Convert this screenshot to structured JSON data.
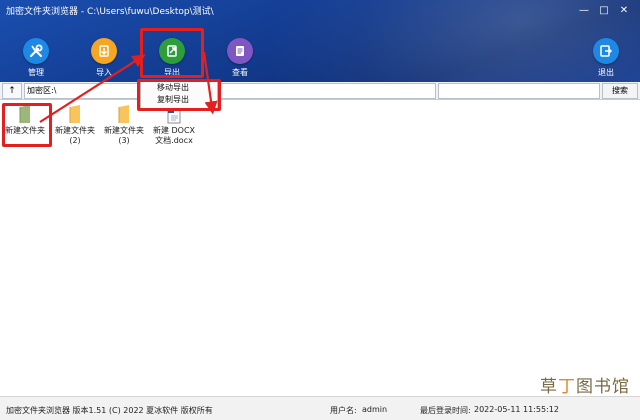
{
  "window": {
    "title": "加密文件夹浏览器  - C:\\Users\\fuwu\\Desktop\\测试\\",
    "minimize": "—",
    "maximize": "□",
    "close": "✕"
  },
  "toolbar": {
    "manage": {
      "label": "管理",
      "icon": "wrench-screwdriver-icon",
      "color": "#1e88e5"
    },
    "import": {
      "label": "导入",
      "icon": "import-file-icon",
      "color": "#f5a623"
    },
    "export": {
      "label": "导出",
      "icon": "export-file-icon",
      "color": "#2e9d3b"
    },
    "view": {
      "label": "查看",
      "icon": "view-document-icon",
      "color": "#7e57c2"
    },
    "exit": {
      "label": "退出",
      "icon": "exit-icon",
      "color": "#1e88e5"
    }
  },
  "addressbar": {
    "up": "↑",
    "path": "加密区:\\",
    "search_value": "",
    "search_button": "搜索"
  },
  "export_menu": {
    "items": [
      "移动导出",
      "复制导出"
    ]
  },
  "files": [
    {
      "name": "新建文件夹",
      "type": "folder"
    },
    {
      "name": "新建文件夹\n(2)",
      "type": "folder"
    },
    {
      "name": "新建文件夹\n(3)",
      "type": "folder"
    },
    {
      "name": "新建 DOCX\n文档.docx",
      "type": "docx"
    }
  ],
  "statusbar": {
    "app_info": "加密文件夹浏览器 版本1.51 (C) 2022 夏冰软件 版权所有",
    "user_label": "用户名:",
    "user_value": "admin",
    "login_label": "最后登录时间:",
    "login_value": "2022-05-11 11:55:12"
  },
  "watermark": {
    "part1": "草",
    "part2": "丁",
    "part3": "图书馆"
  },
  "colors": {
    "highlight": "#e41f1f",
    "banner": "#133b8f"
  }
}
